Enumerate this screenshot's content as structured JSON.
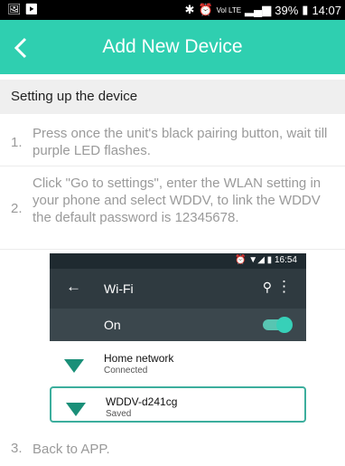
{
  "status_bar": {
    "right_text": "39%",
    "time": "14:07",
    "net_label": "Vol LTE"
  },
  "app_bar": {
    "title": "Add New Device"
  },
  "section": {
    "title": "Setting up the device"
  },
  "steps": [
    {
      "num": "1.",
      "text": "Press once the unit's black pairing button, wait till purple LED flashes."
    },
    {
      "num": "2.",
      "text": "Click \"Go to settings\", enter the WLAN setting in your phone and select WDDV, to link the WDDV the default password is 12345678."
    },
    {
      "num": "3.",
      "text": "Back to APP."
    }
  ],
  "wifi_screenshot": {
    "time": "16:54",
    "title": "Wi-Fi",
    "on_label": "On",
    "networks": [
      {
        "name": "Home network",
        "status": "Connected"
      },
      {
        "name": "WDDV-d241cg",
        "status": "Saved"
      }
    ]
  },
  "colors": {
    "accent": "#2fcfb0",
    "wifi_icon": "#1a8f78"
  }
}
